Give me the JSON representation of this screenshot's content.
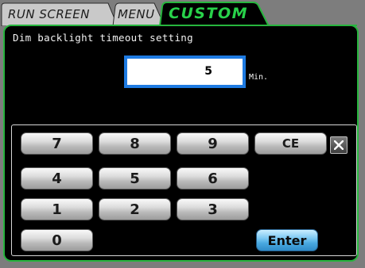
{
  "tabs": [
    {
      "label": "Run screen",
      "active": false
    },
    {
      "label": "Menu",
      "active": false
    },
    {
      "label": "Custom",
      "active": true
    }
  ],
  "setting": {
    "title": "Dim backlight timeout setting",
    "value": "5",
    "unit": "Min."
  },
  "keypad": {
    "keys": [
      "7",
      "8",
      "9",
      "CE",
      "4",
      "5",
      "6",
      "1",
      "2",
      "3",
      "0",
      "Enter"
    ],
    "close_icon": "close-icon"
  },
  "colors": {
    "accent_green": "#27b53e",
    "field_border_blue": "#1e7be2",
    "enter_blue": "#48a8e0"
  }
}
